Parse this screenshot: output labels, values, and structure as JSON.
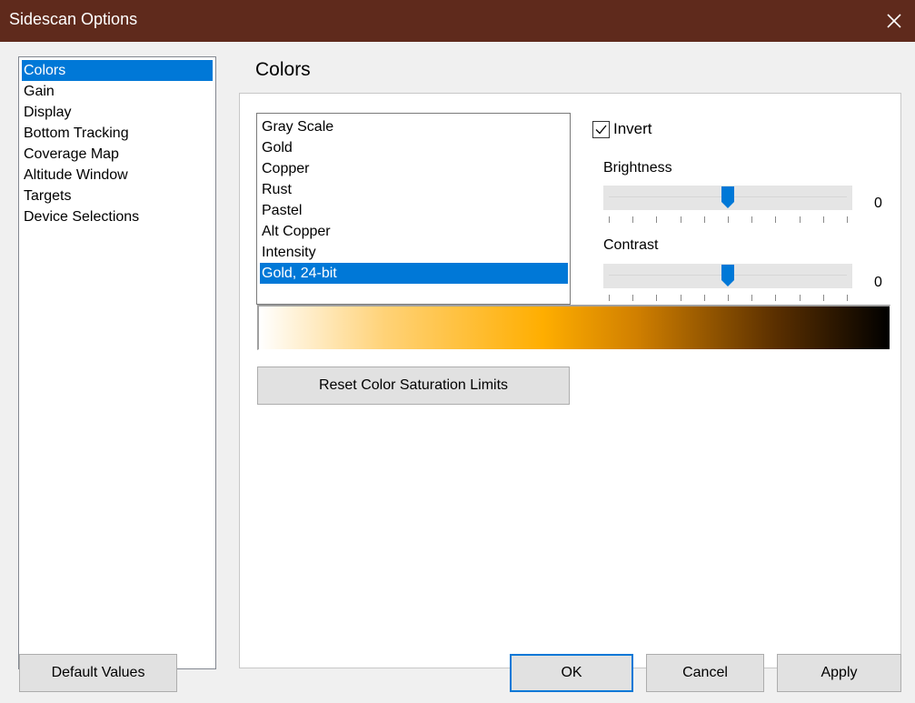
{
  "window": {
    "title": "Sidescan Options",
    "close_glyph": "✕"
  },
  "nav": {
    "items": [
      {
        "label": "Colors",
        "selected": true
      },
      {
        "label": "Gain"
      },
      {
        "label": "Display"
      },
      {
        "label": "Bottom Tracking"
      },
      {
        "label": "Coverage Map"
      },
      {
        "label": "Altitude Window"
      },
      {
        "label": "Targets"
      },
      {
        "label": "Device Selections"
      }
    ]
  },
  "page": {
    "title": "Colors",
    "schemes": [
      {
        "label": "Gray Scale"
      },
      {
        "label": "Gold"
      },
      {
        "label": "Copper"
      },
      {
        "label": "Rust"
      },
      {
        "label": "Pastel"
      },
      {
        "label": "Alt Copper"
      },
      {
        "label": "Intensity"
      },
      {
        "label": "Gold, 24-bit",
        "selected": true
      }
    ],
    "invert": {
      "label": "Invert",
      "checked": true
    },
    "brightness": {
      "label": "Brightness",
      "value": "0",
      "position_fraction": 0.5
    },
    "contrast": {
      "label": "Contrast",
      "value": "0",
      "position_fraction": 0.5
    },
    "reset_button": "Reset Color Saturation Limits"
  },
  "footer": {
    "default_values": "Default Values",
    "ok": "OK",
    "cancel": "Cancel",
    "apply": "Apply"
  },
  "colors": {
    "titlebar": "#5f2a1c",
    "accent": "#0078d7"
  }
}
